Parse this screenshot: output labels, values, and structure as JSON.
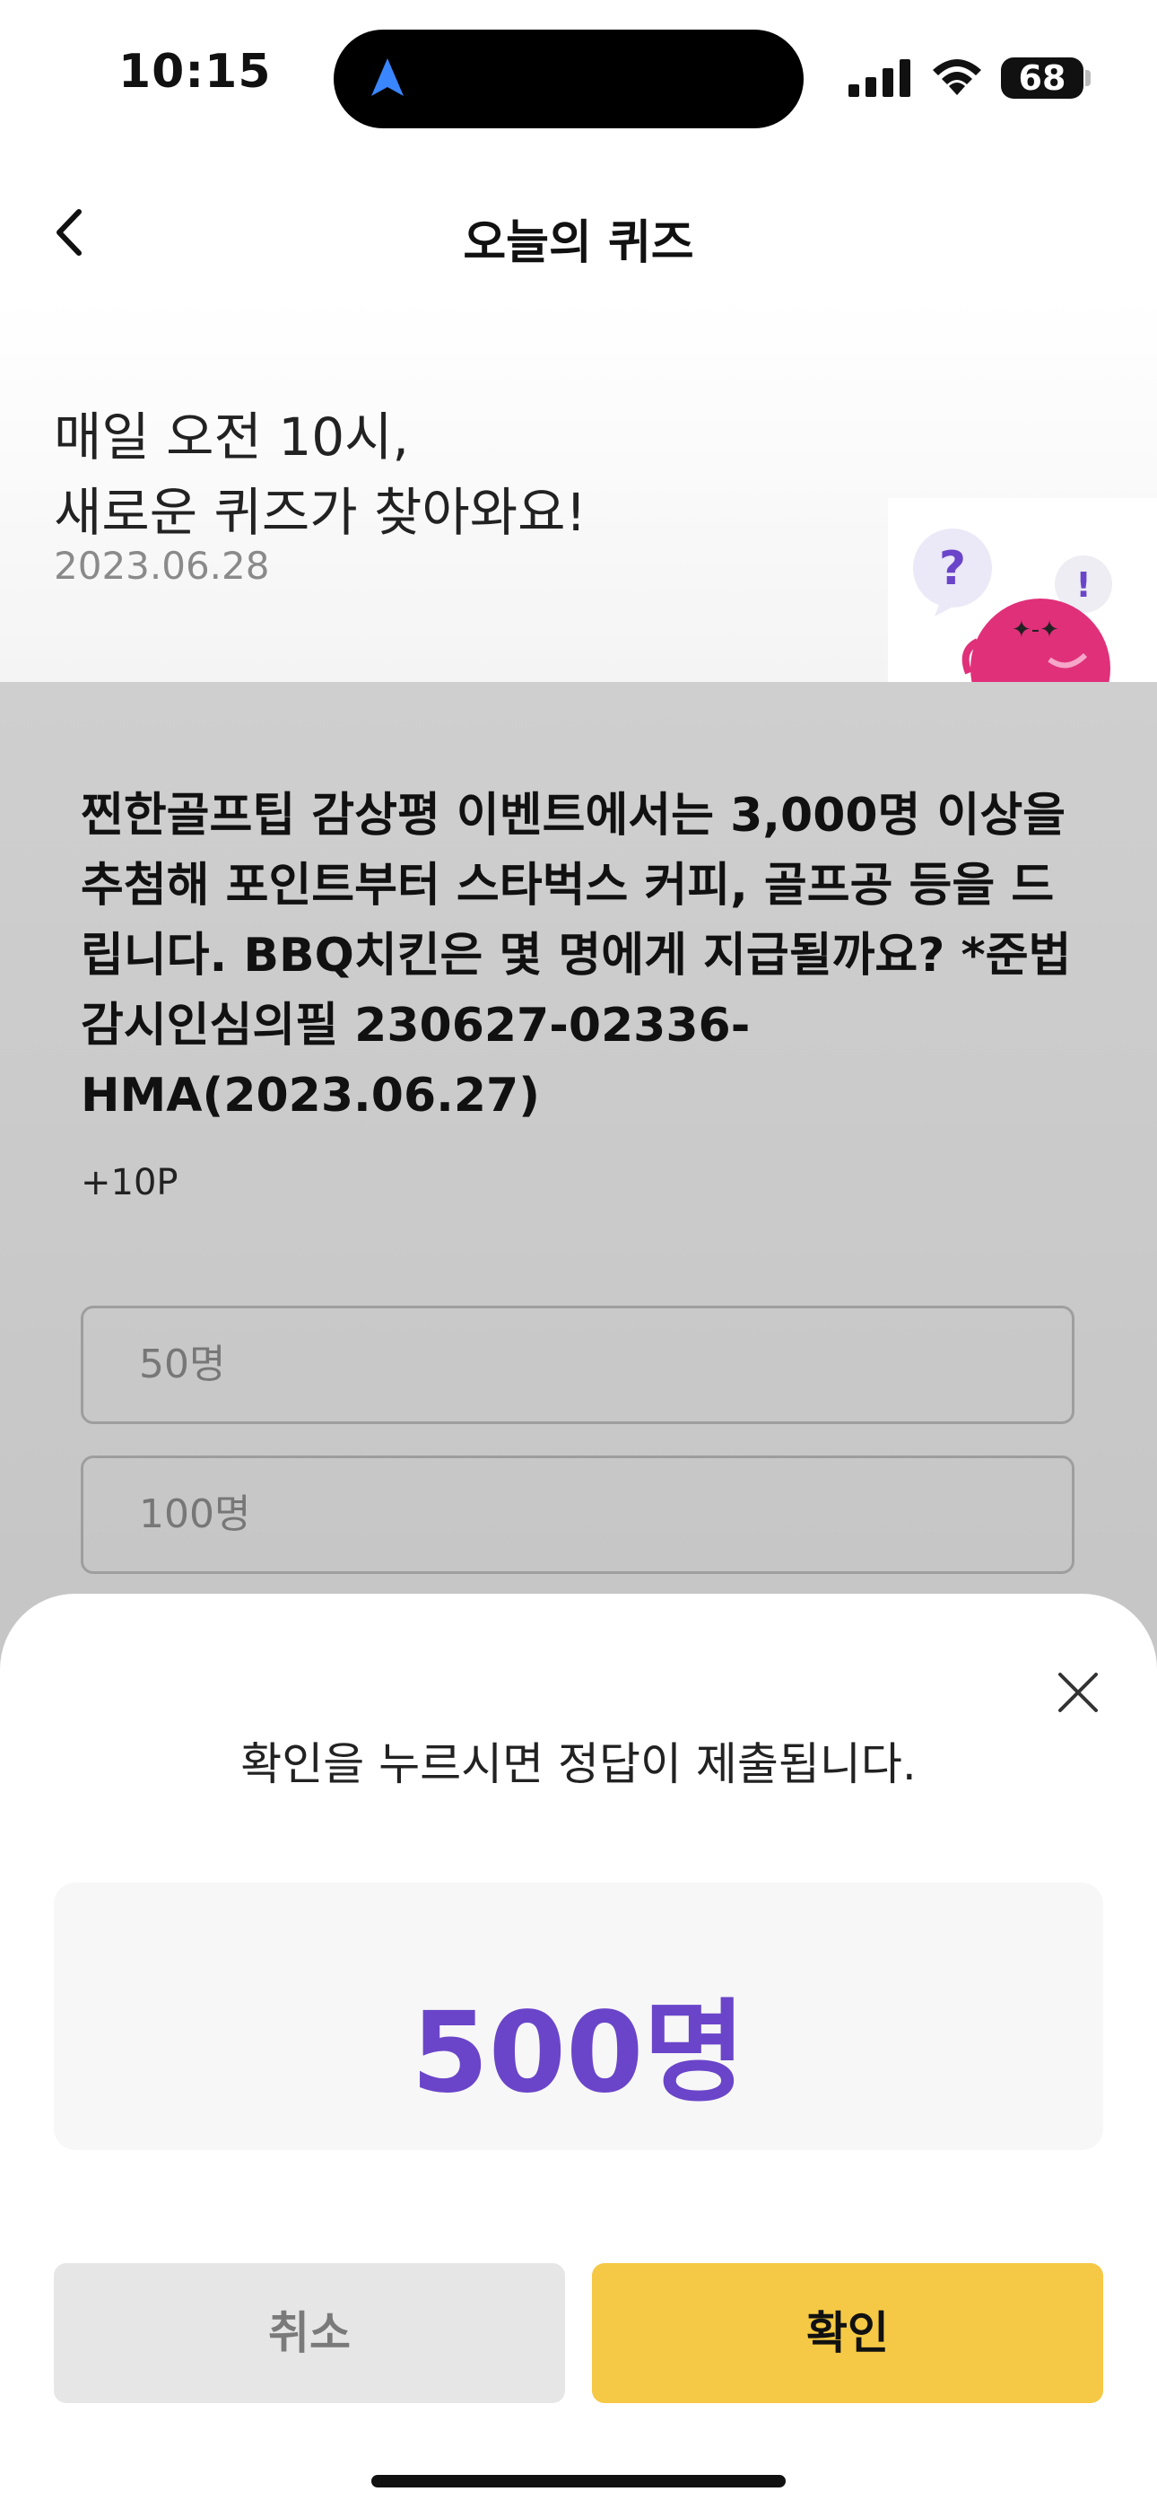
{
  "status_bar": {
    "time": "10:15",
    "battery": "68",
    "icons": [
      "location-arrow-icon",
      "signal-icon",
      "wifi-icon",
      "battery-icon"
    ]
  },
  "header": {
    "title": "오늘의 퀴즈",
    "back_icon": "chevron-left-icon"
  },
  "banner": {
    "line1": "매일 오전 10시,",
    "line2": "새로운 퀴즈가 찾아와요!",
    "date": "2023.06.28"
  },
  "quiz": {
    "question": "찐한골프팁 감상평 이벤트에서는 3,000명 이상을 추첨해 포인트부터 스타벅스 커피, 골프공 등을 드립니다. BBQ치킨은 몇 명에게 지급될까요? *준법감시인심의필 230627-02336-HMA(2023.06.27)",
    "points": "+10P",
    "options": [
      "50명",
      "100명"
    ]
  },
  "sheet": {
    "message": "확인을 누르시면 정답이 제출됩니다.",
    "selected_answer": "500명",
    "cancel_label": "취소",
    "confirm_label": "확인"
  },
  "colors": {
    "accent_purple": "#6a45c9",
    "confirm_yellow": "#f5c945",
    "cancel_gray": "#e6e6e6",
    "mascot_pink": "#e0307a"
  }
}
